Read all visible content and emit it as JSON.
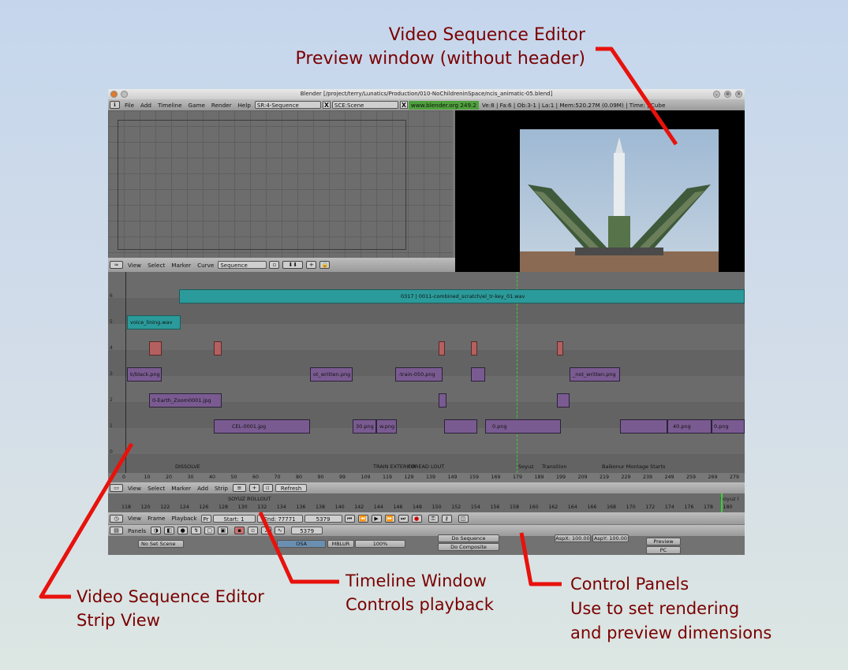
{
  "callouts": {
    "preview": {
      "line1": "Video Sequence Editor",
      "line2": "Preview window (without header)"
    },
    "strip_view": {
      "line1": "Video Sequence Editor",
      "line2": "Strip View"
    },
    "timeline": {
      "line1": "Timeline Window",
      "line2": "Controls playback"
    },
    "control_panels": {
      "line1": "Control Panels",
      "line2": "Use to set rendering",
      "line3": "and preview dimensions"
    },
    "color": "#7a0000",
    "arrow_color": "#e8120c"
  },
  "window": {
    "title": "Blender [/project/terry/Lunatics/Production/010-NoChildreninSpace/ncis_animatic-05.blend]",
    "buttons": [
      "⌄",
      "⊗",
      "✕"
    ]
  },
  "info_header": {
    "menus": [
      "File",
      "Add",
      "Timeline",
      "Game",
      "Render",
      "Help"
    ],
    "screen": "SR:4-Sequence",
    "scene": "SCE:Scene",
    "website": "www.blender.org 249.2",
    "stats": "Ve:8 | Fa:6 | Ob:3-1 | La:1  | Mem:520.27M (0.09M) | Time: | Cube"
  },
  "ipo_header": {
    "menus": [
      "View",
      "Select",
      "Marker",
      "Curve"
    ],
    "mode": "Sequence"
  },
  "sequence": {
    "channels": [
      "6",
      "5",
      "4",
      "3",
      "2",
      "1",
      "0"
    ],
    "strips": {
      "audio_long": "0317 | 0011-combined_scratch/el_tr-key_01.wav",
      "voice": "voice_lining.wav",
      "black": "k/black.png",
      "written": "ot_written.png",
      "train": "-train-050.png",
      "not_written": "_not_written.png",
      "earth": "0-Earth_Zoom0001.jpg",
      "cel": "CEL-0001.jpg",
      "png30": "30.png",
      "wpng": "w.png",
      "png0": "0.png",
      "png40": "40.png",
      "png0b": "0.png"
    },
    "markers": [
      "DISSOLVE",
      "TRAIN EXTERIOR",
      "FOREAD LOUT",
      "Soyuz",
      "Transition",
      "Baikonur Montage Starts"
    ],
    "ruler": [
      "0",
      "10",
      "20",
      "30",
      "40",
      "50",
      "60",
      "70",
      "80",
      "90",
      "99",
      "109",
      "119",
      "129",
      "139",
      "149",
      "159",
      "169",
      "179",
      "189",
      "199",
      "209",
      "219",
      "229",
      "239",
      "249",
      "259",
      "269",
      "279"
    ]
  },
  "seq_header": {
    "menus": [
      "View",
      "Select",
      "Marker",
      "Add",
      "Strip"
    ],
    "refresh": "Refresh"
  },
  "timeline": {
    "marker_label": "SOYUZ ROLLOUT",
    "marker_label2": "Soyuz I",
    "ruler": [
      "118",
      "120",
      "122",
      "124",
      "126",
      "128",
      "130",
      "132",
      "134",
      "136",
      "138",
      "140",
      "142",
      "144",
      "146",
      "148",
      "150",
      "152",
      "154",
      "156",
      "158",
      "160",
      "162",
      "164",
      "166",
      "168",
      "170",
      "172",
      "174",
      "176",
      "178",
      "180"
    ],
    "menus": [
      "View",
      "Frame",
      "Playback"
    ],
    "pr": "Pr",
    "start": "Start: 1",
    "end": "End: 77771",
    "current": "5379",
    "transport": [
      "⏮",
      "⏪",
      "▶",
      "⏩",
      "⏭",
      "●"
    ]
  },
  "buttons_window": {
    "panels_label": "Panels",
    "frame": "5379",
    "scene_field": "No Set Scene",
    "osa": "OSA",
    "mblur": "MBLUR",
    "pct": "100%",
    "do_sequence": "Do Sequence",
    "do_composite": "Do Composite",
    "aspx": "AspX: 100.00",
    "aspy": "AspY: 100.00",
    "preview": "Preview",
    "pc": "PC"
  }
}
